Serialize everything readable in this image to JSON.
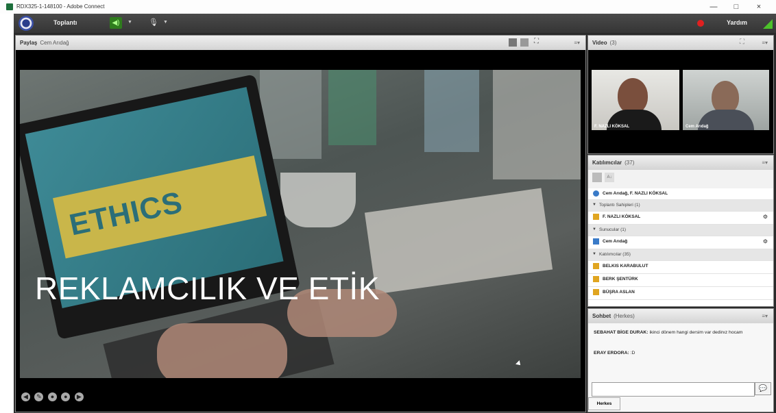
{
  "window": {
    "title": "RDX325-1-148100 - Adobe Connect",
    "min": "—",
    "max": "□",
    "close": "×"
  },
  "menubar": {
    "toplanti": "Toplantı",
    "yardim": "Yardım"
  },
  "share": {
    "title": "Paylaş",
    "presenter": "Cem Arıdağ",
    "slide_text": "REKLAMCILIK VE ETİK",
    "image_text": "ETHICS"
  },
  "video": {
    "title": "Video",
    "count": "(3)",
    "feeds": [
      {
        "name": "F. NAZLI KÖKSAL"
      },
      {
        "name": "Cem Arıdağ"
      }
    ]
  },
  "attendees": {
    "title": "Katılımcılar",
    "count": "(37)",
    "active_speakers": "Cem Arıdağ, F. NAZLI KÖKSAL",
    "sections": [
      {
        "label": "Toplantı Sahipleri (1)",
        "members": [
          "F. NAZLI KÖKSAL"
        ]
      },
      {
        "label": "Sunucular (1)",
        "members": [
          "Cem Arıdağ"
        ]
      },
      {
        "label": "Katılımcılar (35)",
        "members": [
          "BELKIS KARABULUT",
          "BERK ŞENTÜRK",
          "BÜŞRA ASLAN"
        ]
      }
    ]
  },
  "chat": {
    "title": "Sohbet",
    "scope": "(Herkes)",
    "messages": [
      {
        "sender": "SEBAHAT BİGE DURAK:",
        "text": "ikinci dönem hangi dersim var dedinız hocam"
      },
      {
        "sender": "ERAY ERDORA:",
        "text": ":D"
      }
    ],
    "input_value": "",
    "tab_label": "Herkes"
  },
  "icons": {
    "logo": "adobe-connect-logo",
    "audio": "speaker-icon",
    "mic": "microphone-icon",
    "record": "record-indicator",
    "signal": "connection-signal-icon"
  },
  "colors": {
    "record": "#e02020",
    "audio": "#2f7c1d",
    "signal": "#4cc22a"
  }
}
